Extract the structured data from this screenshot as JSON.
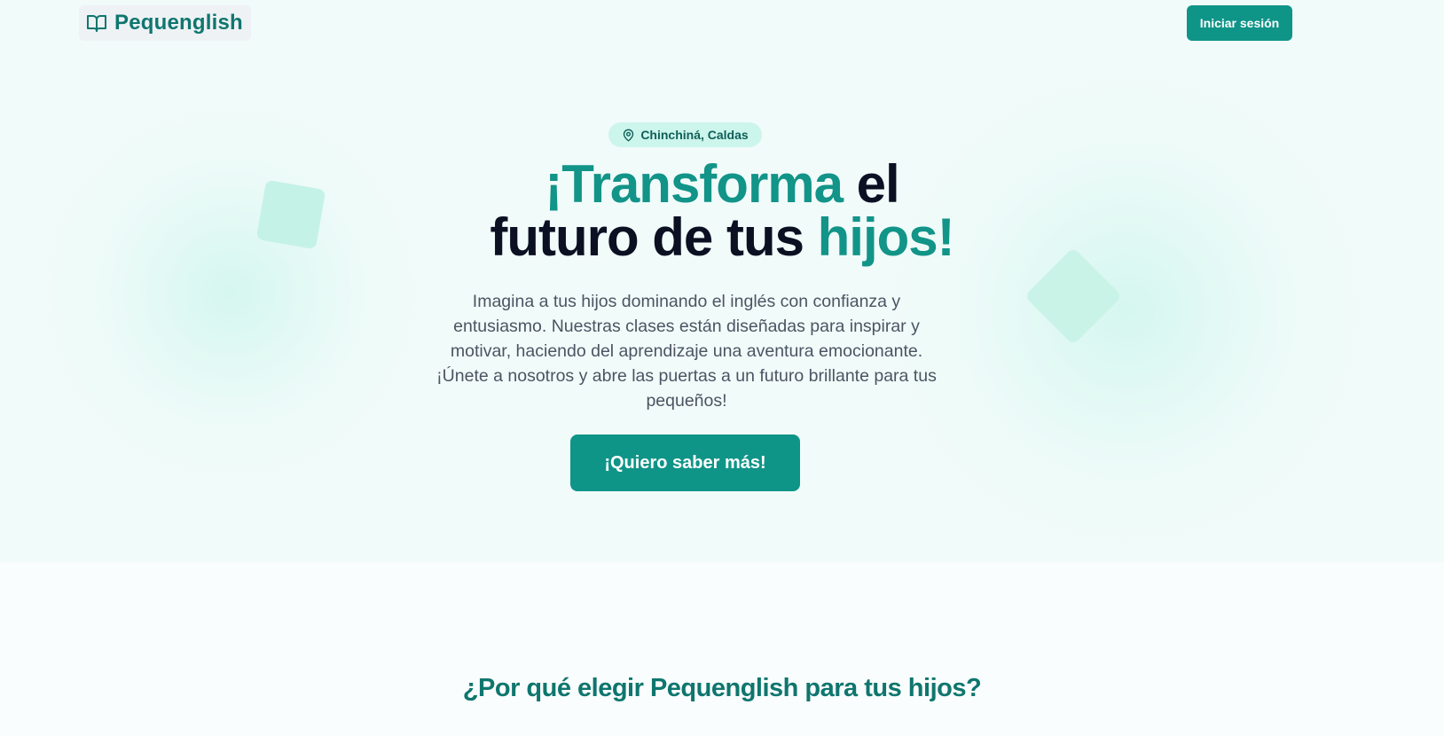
{
  "header": {
    "logo_text": "Pequenglish",
    "logo_icon": "open-book-icon",
    "login_label": "Iniciar sesión"
  },
  "hero": {
    "location_icon": "map-pin-icon",
    "location": "Chinchiná, Caldas",
    "headline": {
      "part1_accent": "¡Transforma",
      "part2": " el",
      "part3": "futuro de tus ",
      "part4_accent": "hijos!"
    },
    "description": "Imagina a tus hijos dominando el inglés con confianza y entusiasmo. Nuestras clases están diseñadas para inspirar y motivar, haciendo del aprendizaje una aventura emocionante. ¡Únete a nosotros y abre las puertas a un futuro brillante para tus pequeños!",
    "cta_label": "¡Quiero saber más!"
  },
  "features": {
    "title": "¿Por qué elegir Pequenglish para tus hijos?"
  },
  "colors": {
    "brand": "#0f9488",
    "brand_dark": "#0f766e",
    "hero_bg": "#f1fbfa",
    "badge_bg": "#ccf5ec",
    "heading": "#0b1022"
  }
}
